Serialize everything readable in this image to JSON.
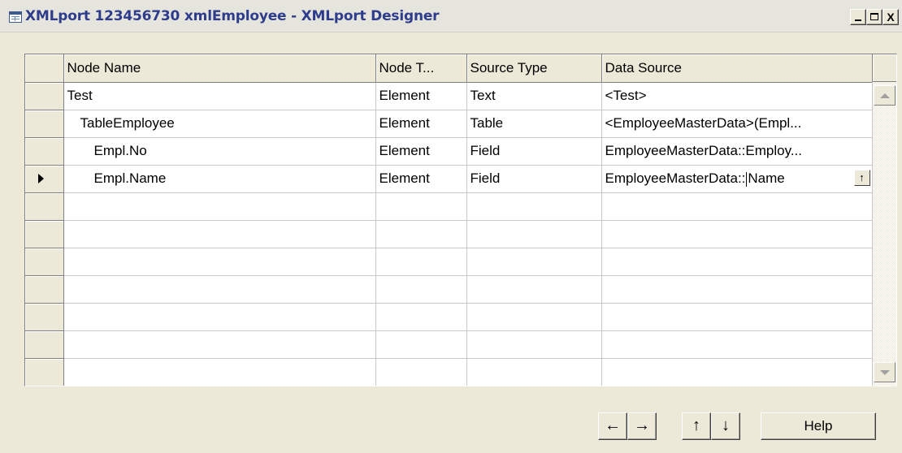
{
  "window": {
    "title": "XMLport 123456730 xmlEmployee - XMLport Designer",
    "icon": "table-icon",
    "controls": [
      "minimize",
      "maximize",
      "close"
    ],
    "close_label": "X"
  },
  "grid": {
    "columns": [
      "Node Name",
      "Node T...",
      "Source Type",
      "Data Source"
    ],
    "rows": [
      {
        "node_name": "Test",
        "node_type": "Element",
        "source_type": "Text",
        "data_source": "<Test>"
      },
      {
        "node_name": "TableEmployee",
        "node_type": "Element",
        "source_type": "Table",
        "data_source": "<EmployeeMasterData>(Empl..."
      },
      {
        "node_name": "Empl.No",
        "node_type": "Element",
        "source_type": "Field",
        "data_source": "EmployeeMasterData::Employ..."
      },
      {
        "node_name": "Empl.Name",
        "node_type": "Element",
        "source_type": "Field",
        "data_source_before_caret": "EmployeeMasterData::",
        "data_source_after_caret": "Name",
        "selected": true
      }
    ],
    "lookup_glyph": "↑",
    "indent_levels": [
      0,
      1,
      2,
      2
    ]
  },
  "buttons": {
    "left": "←",
    "right": "→",
    "up": "↑",
    "down": "↓",
    "help": "Help"
  }
}
